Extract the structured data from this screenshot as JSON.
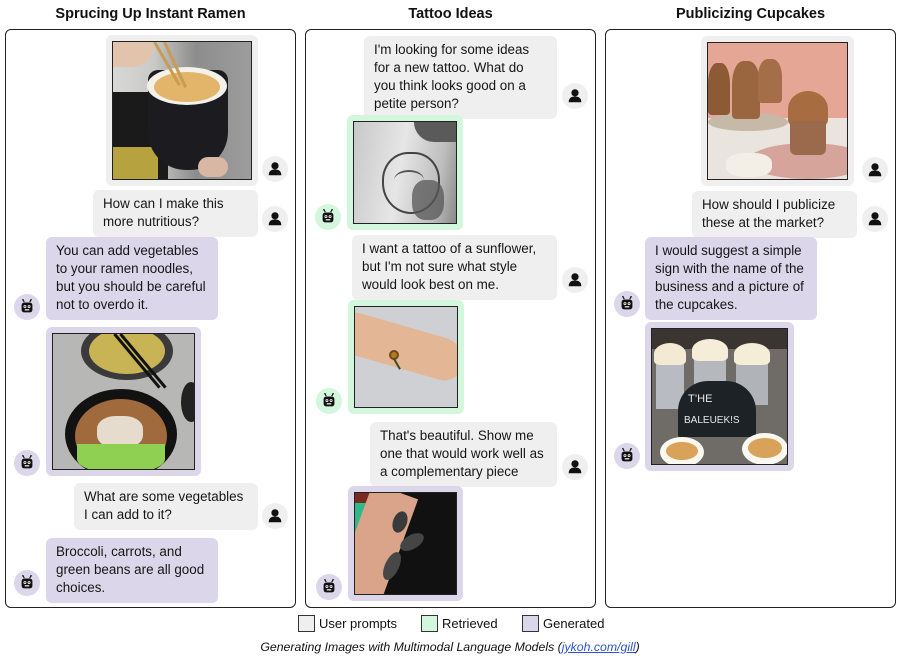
{
  "legend": {
    "user_prompts": "User prompts",
    "retrieved": "Retrieved",
    "generated": "Generated"
  },
  "colors": {
    "user": "#efefef",
    "retrieved": "#d3f7dd",
    "generated": "#dcd6ea"
  },
  "caption": {
    "text": "Generating Images with Multimodal Language Models (",
    "link": "jykoh.com/gill",
    "close": ")"
  },
  "panels": [
    {
      "title": "Sprucing Up Instant Ramen",
      "messages": [
        {
          "role": "user",
          "type": "image",
          "description": "hand holding chopsticks over a bowl of instant ramen noodles"
        },
        {
          "role": "user",
          "type": "text",
          "text": "How can I make this more nutritious?"
        },
        {
          "role": "generated",
          "type": "text",
          "text": "You can add vegetables to your ramen noodles, but you should be careful not to overdo it."
        },
        {
          "role": "generated",
          "type": "image",
          "description": "bowls of noodles with vegetables and chopsticks"
        },
        {
          "role": "user",
          "type": "text",
          "text": "What are some vegetables I can add to it?"
        },
        {
          "role": "generated",
          "type": "text",
          "text": "Broccoli, carrots, and green beans are all good choices."
        }
      ]
    },
    {
      "title": "Tattoo Ideas",
      "messages": [
        {
          "role": "user",
          "type": "text",
          "text": "I'm looking for some ideas for a new tattoo. What do you think looks good on a petite person?"
        },
        {
          "role": "retrieved",
          "type": "image",
          "description": "fox and flowers tattoo on a back"
        },
        {
          "role": "user",
          "type": "text",
          "text": "I want a tattoo of a sunflower, but I'm not sure what style would look best on me."
        },
        {
          "role": "retrieved",
          "type": "image",
          "description": "small sunflower tattoo on an arm"
        },
        {
          "role": "user",
          "type": "text",
          "text": "That's beautiful. Show me one that would work well as a complementary piece"
        },
        {
          "role": "generated",
          "type": "image",
          "description": "floral leaf tattoo on a forearm"
        }
      ]
    },
    {
      "title": "Publicizing Cupcakes",
      "messages": [
        {
          "role": "user",
          "type": "image",
          "description": "chocolate frosted cupcakes on pink plates"
        },
        {
          "role": "user",
          "type": "text",
          "text": "How should I publicize these at the market?"
        },
        {
          "role": "generated",
          "type": "text",
          "text": "I would suggest a simple sign with the name of the business and a picture of the cupcakes."
        },
        {
          "role": "generated",
          "type": "image",
          "description": "cupcakes with a chalkboard sign at a market stall"
        }
      ]
    }
  ],
  "icons": {
    "user": "user-person-icon",
    "bot": "robot-icon"
  }
}
